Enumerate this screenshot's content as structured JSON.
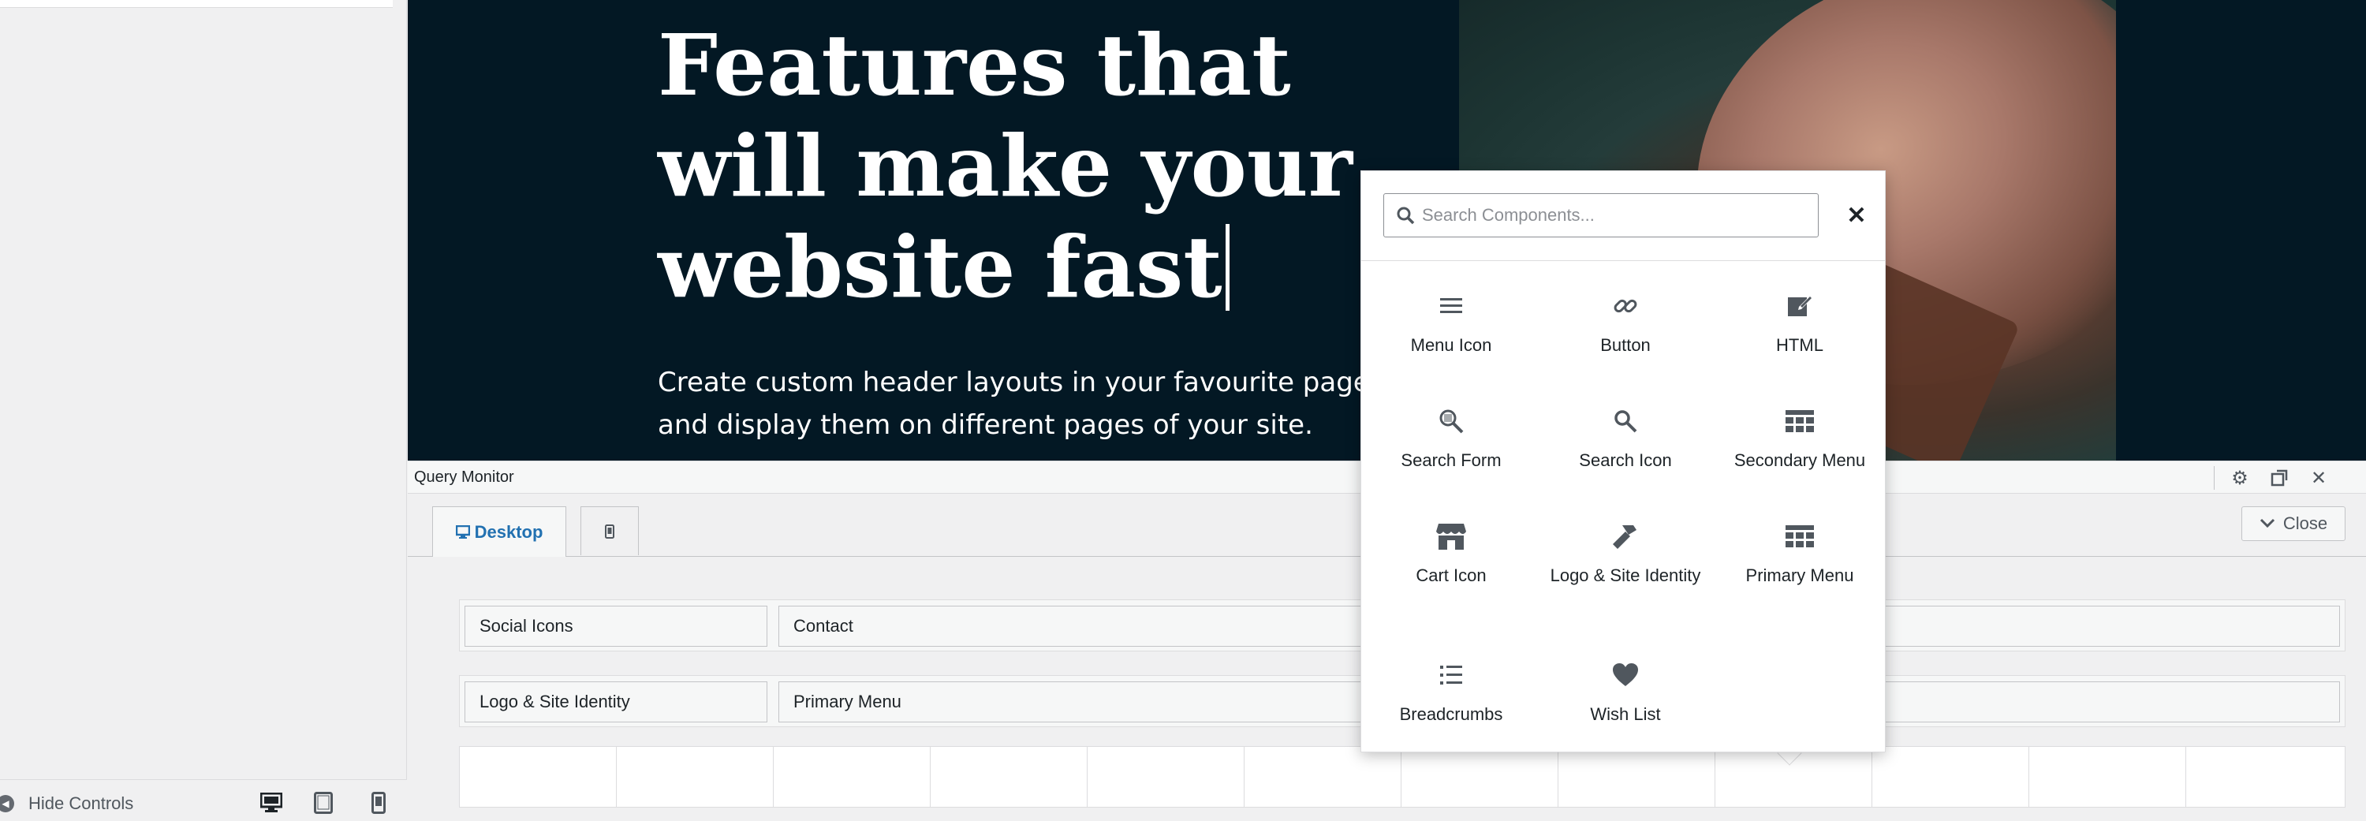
{
  "sidebar": {
    "hide_controls": "Hide Controls",
    "devices": [
      "desktop-icon",
      "tablet-icon",
      "mobile-icon"
    ]
  },
  "hero": {
    "title": "Features that will make your website fast",
    "subtitle_line1": "Create custom header layouts in your favourite page bu",
    "subtitle_line2": "and display them on different pages of your site."
  },
  "query_monitor": {
    "title": "Query Monitor"
  },
  "builder": {
    "tabs": [
      {
        "label": "Desktop",
        "icon": "desktop-icon"
      },
      {
        "label": "",
        "icon": "mobile-icon"
      }
    ],
    "close_label": "Close",
    "rows": {
      "top": {
        "left": "Social Icons",
        "center": "Contact"
      },
      "main": {
        "left": "Logo & Site Identity",
        "center": "Primary Menu"
      }
    }
  },
  "picker": {
    "search_placeholder": "Search Components...",
    "components": [
      {
        "label": "Menu Icon",
        "icon": "menu-icon"
      },
      {
        "label": "Button",
        "icon": "link-icon"
      },
      {
        "label": "HTML",
        "icon": "edit-icon"
      },
      {
        "label": "Search Form",
        "icon": "search-form-icon"
      },
      {
        "label": "Search Icon",
        "icon": "search-icon"
      },
      {
        "label": "Secondary Menu",
        "icon": "menu-grid-icon"
      },
      {
        "label": "Cart Icon",
        "icon": "store-icon"
      },
      {
        "label": "Logo & Site Identity",
        "icon": "hammer-icon"
      },
      {
        "label": "Primary Menu",
        "icon": "menu-grid-icon"
      },
      {
        "label": "Breadcrumbs",
        "icon": "list-icon"
      },
      {
        "label": "Wish List",
        "icon": "heart-icon"
      }
    ]
  },
  "colors": {
    "hero_bg": "#031824",
    "accent": "#2271b1",
    "panel_bg": "#f0f0f1"
  }
}
